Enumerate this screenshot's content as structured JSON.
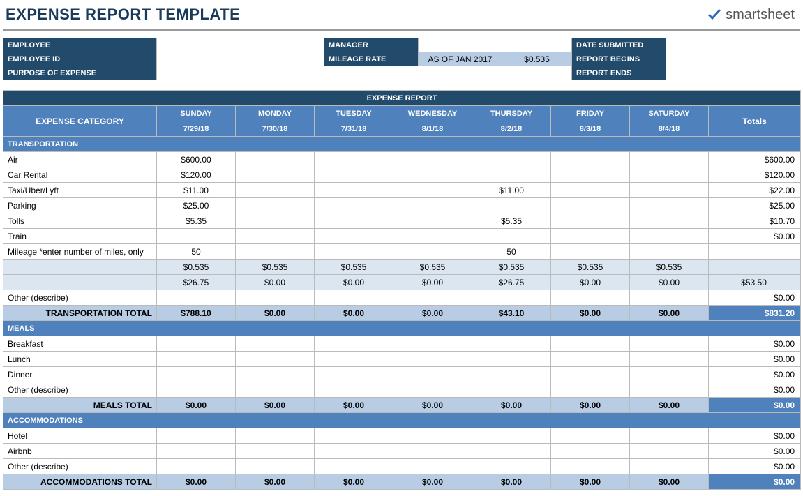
{
  "title": "EXPENSE REPORT TEMPLATE",
  "logo_text": "smartsheet",
  "meta": {
    "employee_label": "EMPLOYEE",
    "employee_value": "",
    "employee_id_label": "EMPLOYEE ID",
    "employee_id_value": "",
    "purpose_label": "PURPOSE OF EXPENSE",
    "purpose_value": "",
    "manager_label": "MANAGER",
    "manager_value": "",
    "mileage_rate_label": "MILEAGE RATE",
    "mileage_rate_note": "AS OF JAN 2017",
    "mileage_rate_value": "$0.535",
    "date_submitted_label": "DATE SUBMITTED",
    "date_submitted_value": "",
    "report_begins_label": "REPORT BEGINS",
    "report_begins_value": "",
    "report_ends_label": "REPORT ENDS",
    "report_ends_value": ""
  },
  "report": {
    "header": "EXPENSE REPORT",
    "category_label": "EXPENSE CATEGORY",
    "totals_label": "Totals",
    "days": [
      "SUNDAY",
      "MONDAY",
      "TUESDAY",
      "WEDNESDAY",
      "THURSDAY",
      "FRIDAY",
      "SATURDAY"
    ],
    "dates": [
      "7/29/18",
      "7/30/18",
      "7/31/18",
      "8/1/18",
      "8/2/18",
      "8/3/18",
      "8/4/18"
    ],
    "sections": {
      "transportation": {
        "label": "TRANSPORTATION",
        "total_label": "TRANSPORTATION TOTAL",
        "rows": [
          {
            "name": "Air",
            "vals": [
              "$600.00",
              "",
              "",
              "",
              "",
              "",
              ""
            ],
            "total": "$600.00"
          },
          {
            "name": "Car Rental",
            "vals": [
              "$120.00",
              "",
              "",
              "",
              "",
              "",
              ""
            ],
            "total": "$120.00"
          },
          {
            "name": "Taxi/Uber/Lyft",
            "vals": [
              "$11.00",
              "",
              "",
              "",
              "$11.00",
              "",
              ""
            ],
            "total": "$22.00"
          },
          {
            "name": "Parking",
            "vals": [
              "$25.00",
              "",
              "",
              "",
              "",
              "",
              ""
            ],
            "total": "$25.00"
          },
          {
            "name": "Tolls",
            "vals": [
              "$5.35",
              "",
              "",
              "",
              "$5.35",
              "",
              ""
            ],
            "total": "$10.70"
          },
          {
            "name": "Train",
            "vals": [
              "",
              "",
              "",
              "",
              "",
              "",
              ""
            ],
            "total": "$0.00"
          }
        ],
        "mileage_row": {
          "name": "Mileage *enter number of miles, only",
          "vals": [
            "50",
            "",
            "",
            "",
            "50",
            "",
            ""
          ]
        },
        "rate_row": [
          "$0.535",
          "$0.535",
          "$0.535",
          "$0.535",
          "$0.535",
          "$0.535",
          "$0.535"
        ],
        "calc_row": {
          "vals": [
            "$26.75",
            "$0.00",
            "$0.00",
            "$0.00",
            "$26.75",
            "$0.00",
            "$0.00"
          ],
          "total": "$53.50"
        },
        "other_row": {
          "name": "Other (describe)",
          "vals": [
            "",
            "",
            "",
            "",
            "",
            "",
            ""
          ],
          "total": "$0.00"
        },
        "totals": [
          "$788.10",
          "$0.00",
          "$0.00",
          "$0.00",
          "$43.10",
          "$0.00",
          "$0.00"
        ],
        "grand_total": "$831.20"
      },
      "meals": {
        "label": "MEALS",
        "total_label": "MEALS TOTAL",
        "rows": [
          {
            "name": "Breakfast",
            "vals": [
              "",
              "",
              "",
              "",
              "",
              "",
              ""
            ],
            "total": "$0.00"
          },
          {
            "name": "Lunch",
            "vals": [
              "",
              "",
              "",
              "",
              "",
              "",
              ""
            ],
            "total": "$0.00"
          },
          {
            "name": "Dinner",
            "vals": [
              "",
              "",
              "",
              "",
              "",
              "",
              ""
            ],
            "total": "$0.00"
          },
          {
            "name": "Other (describe)",
            "vals": [
              "",
              "",
              "",
              "",
              "",
              "",
              ""
            ],
            "total": "$0.00"
          }
        ],
        "totals": [
          "$0.00",
          "$0.00",
          "$0.00",
          "$0.00",
          "$0.00",
          "$0.00",
          "$0.00"
        ],
        "grand_total": "$0.00"
      },
      "accommodations": {
        "label": "ACCOMMODATIONS",
        "total_label": "ACCOMMODATIONS TOTAL",
        "rows": [
          {
            "name": "Hotel",
            "vals": [
              "",
              "",
              "",
              "",
              "",
              "",
              ""
            ],
            "total": "$0.00"
          },
          {
            "name": "Airbnb",
            "vals": [
              "",
              "",
              "",
              "",
              "",
              "",
              ""
            ],
            "total": "$0.00"
          },
          {
            "name": "Other (describe)",
            "vals": [
              "",
              "",
              "",
              "",
              "",
              "",
              ""
            ],
            "total": "$0.00"
          }
        ],
        "totals": [
          "$0.00",
          "$0.00",
          "$0.00",
          "$0.00",
          "$0.00",
          "$0.00",
          "$0.00"
        ],
        "grand_total": "$0.00"
      }
    }
  }
}
